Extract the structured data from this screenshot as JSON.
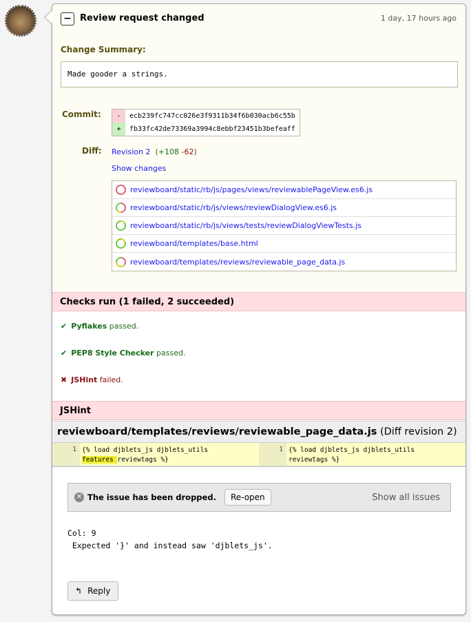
{
  "header": {
    "title": "Review request changed",
    "timestamp": "1 day, 17 hours ago",
    "collapse_label": "−"
  },
  "change_summary": {
    "label": "Change Summary:",
    "text": "Made gooder a strings."
  },
  "commit": {
    "label": "Commit:",
    "old": {
      "sign": "-",
      "hash": "ecb239fc747cc026e3f9311b34f6b030acb6c55b"
    },
    "new": {
      "sign": "+",
      "hash": "fb33fc42de73369a3994c8ebbf23451b3befeaff"
    }
  },
  "diff": {
    "label": "Diff:",
    "revision": "Revision 2",
    "open": "(",
    "added": "+108",
    "removed": "-62",
    "close": ")",
    "show_changes": "Show changes",
    "files": [
      {
        "path": "reviewboard/static/rb/js/pages/views/reviewablePageView.es6.js",
        "deleted": 1.0,
        "inserted": 0.0,
        "replaced": 0.0
      },
      {
        "path": "reviewboard/static/rb/js/views/reviewDialogView.es6.js",
        "deleted": 0.5,
        "inserted": 0.35,
        "replaced": 0.15
      },
      {
        "path": "reviewboard/static/rb/js/views/tests/reviewDialogViewTests.js",
        "deleted": 0.0,
        "inserted": 0.85,
        "replaced": 0.15
      },
      {
        "path": "reviewboard/templates/base.html",
        "deleted": 0.0,
        "inserted": 0.8,
        "replaced": 0.2
      },
      {
        "path": "reviewboard/templates/reviews/reviewable_page_data.js",
        "deleted": 0.35,
        "inserted": 0.25,
        "replaced": 0.4
      }
    ]
  },
  "checks": {
    "title": "Checks run (1 failed, 2 succeeded)",
    "items": [
      {
        "name": "Pyflakes",
        "status": "passed.",
        "ok": true
      },
      {
        "name": "PEP8 Style Checker",
        "status": "passed.",
        "ok": true
      },
      {
        "name": "JSHint",
        "status": "failed.",
        "ok": false
      }
    ]
  },
  "jshint": {
    "title": "JSHint",
    "file": "reviewboard/templates/reviews/reviewable_page_data.js",
    "revision": "(Diff revision 2)",
    "left": {
      "line": "1",
      "pre": "{% load djblets_js djblets_utils",
      "hl": "features ",
      "post": "reviewtags %}"
    },
    "right": {
      "line": "1",
      "text1": "{% load djblets_js djblets_utils",
      "text2": "reviewtags %}"
    },
    "issue_status": "The issue has been dropped.",
    "reopen": "Re-open",
    "show_all": "Show all issues",
    "comment": "Col: 9\n Expected '}' and instead saw 'djblets_js'.",
    "reply": "Reply"
  },
  "colors": {
    "deleted": "#e06070",
    "inserted": "#66cc44",
    "replaced": "#d8d020",
    "pass": "#1a6a1a",
    "fail": "#8a1010"
  }
}
